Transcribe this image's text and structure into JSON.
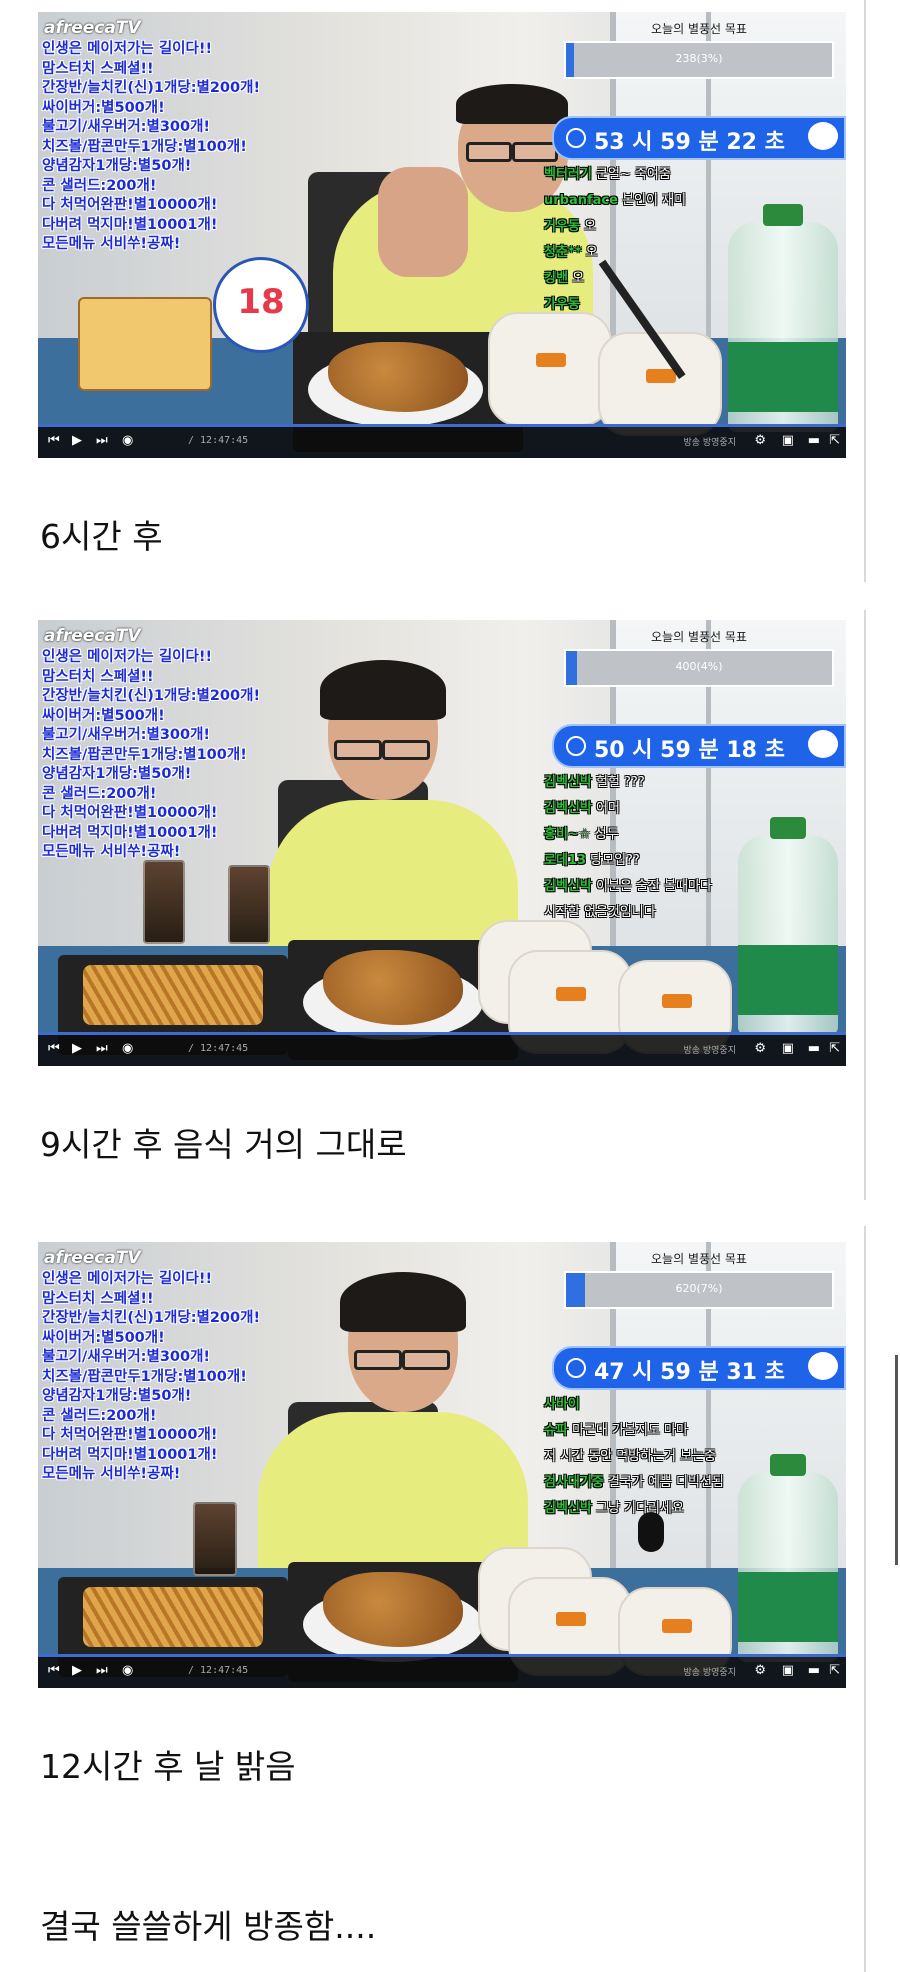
{
  "common": {
    "logo": "afreecaTV",
    "menu": [
      "인생은 메이저가는 길이다!!",
      "맘스터치 스페셜!!",
      "간장반/늘치킨(신)1개당:별200개!",
      "싸이버거:별500개!",
      "불고기/새우버거:별300개!",
      "치즈볼/팝콘만두1개당:별100개!",
      "양념감자1개당:별50개!",
      "콘 샐러드:200개!",
      "다 처먹어완판!별10000개!",
      "다버려 먹지마!별10001개!",
      "모든메뉴 서비쑤!공짜!"
    ],
    "goal_title": "오늘의 별풍선 목표",
    "time_code": "/ 12:47:45",
    "status_text": "방송 방영중지"
  },
  "panels": [
    {
      "caption": "6시간 후",
      "goal_text": "238(3%)",
      "goal_fraction": 0.03,
      "timer": "53 시 59 분 22 초",
      "chat": [
        {
          "nick": "벡터러기",
          "msg": "쿤얼~ 죽여줌"
        },
        {
          "nick": "urbanface",
          "msg": "본인이 재미"
        },
        {
          "nick": "거우동",
          "msg": "오"
        },
        {
          "nick": "청춘**",
          "msg": "오"
        },
        {
          "nick": "킹밴",
          "msg": "오"
        },
        {
          "nick": "가우동",
          "msg": ""
        }
      ]
    },
    {
      "caption": "9시간 후 음식 거의 그대로",
      "goal_text": "400(4%)",
      "goal_fraction": 0.04,
      "timer": "50 시 59 분 18 초",
      "chat": [
        {
          "nick": "김벡신박",
          "msg": "헐헐 ???"
        },
        {
          "nick": "김벡신박",
          "msg": "어머"
        },
        {
          "nick": "홍비~☆",
          "msg": "성두"
        },
        {
          "nick": "로데13",
          "msg": "당모입??"
        },
        {
          "nick": "김벡신박",
          "msg": "이분은 술잔 볼때마다"
        },
        {
          "nick": "",
          "msg": "시작할 없을것임니다"
        }
      ]
    },
    {
      "caption": "12시간 후 날 밝음",
      "goal_text": "620(7%)",
      "goal_fraction": 0.07,
      "timer": "47 시 59 분 31 초",
      "chat": [
        {
          "nick": "사바이",
          "msg": ""
        },
        {
          "nick": "슈파",
          "msg": "마근대 가볼지도 마마"
        },
        {
          "nick": "",
          "msg": "저 시간 동안 먹방하는거 보는중"
        },
        {
          "nick": "",
          "msg": ""
        },
        {
          "nick": "검사대기중",
          "msg": "결국가 예쁨 디빅션됨"
        },
        {
          "nick": "김벡신박",
          "msg": "그냥 기다리세요"
        }
      ]
    }
  ],
  "final_text": "결국 쓸쓸하게 방종함...."
}
